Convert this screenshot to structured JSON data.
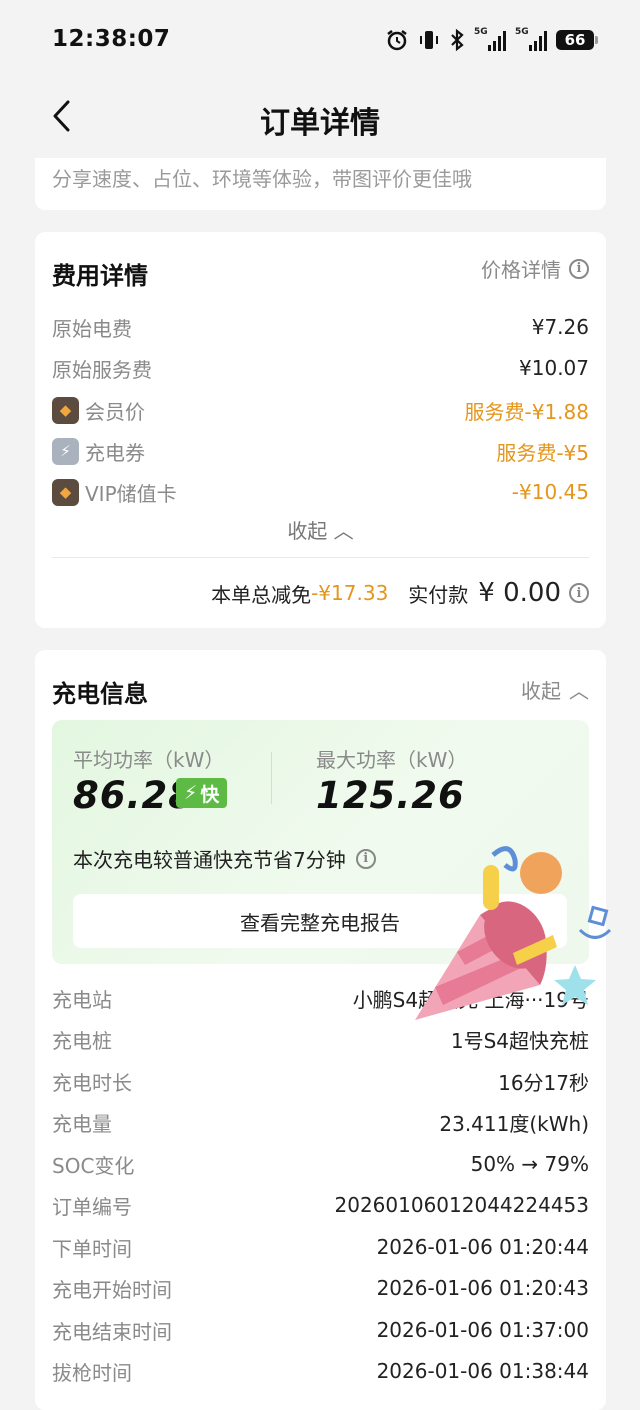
{
  "status_bar": {
    "time": "12:38:07",
    "battery": "66",
    "net1": "5G",
    "net2": "5G"
  },
  "header": {
    "title": "订单详情"
  },
  "review_tip": "分享速度、占位、环境等体验，带图评价更佳哦",
  "fees": {
    "title": "费用详情",
    "price_link": "价格详情",
    "rows": [
      {
        "label": "原始电费",
        "value": "¥7.26"
      },
      {
        "label": "原始服务费",
        "value": "¥10.07"
      },
      {
        "label": "会员价",
        "value": "服务费-¥1.88"
      },
      {
        "label": "充电券",
        "value": "服务费-¥5"
      },
      {
        "label": "VIP储值卡",
        "value": "-¥10.45"
      }
    ],
    "collapse": "收起",
    "total_label": "本单总减免",
    "total_discount": "-¥17.33",
    "paid_label": "实付款",
    "paid_value": "¥ 0.00"
  },
  "charging": {
    "title": "充电信息",
    "collapse": "收起",
    "avg_label": "平均功率（kW）",
    "avg_value": "86.28",
    "fast_tag": "快",
    "max_label": "最大功率（kW）",
    "max_value": "125.26",
    "save_note": "本次充电较普通快充节省7分钟",
    "report_button": "查看完整充电报告",
    "rows": [
      {
        "label": "充电站",
        "value": "小鹏S4超快充 上海···19号"
      },
      {
        "label": "充电桩",
        "value": "1号S4超快充桩"
      },
      {
        "label": "充电时长",
        "value": "16分17秒"
      },
      {
        "label": "充电量",
        "value": "23.411度(kWh)"
      },
      {
        "label": "SOC变化",
        "value": "50% → 79%"
      },
      {
        "label": "订单编号",
        "value": "20260106012044224453"
      },
      {
        "label": "下单时间",
        "value": "2026-01-06 01:20:44"
      },
      {
        "label": "充电开始时间",
        "value": "2026-01-06 01:20:43"
      },
      {
        "label": "充电结束时间",
        "value": "2026-01-06 01:37:00"
      },
      {
        "label": "拔枪时间",
        "value": "2026-01-06 01:38:44"
      }
    ]
  },
  "colors": {
    "accent_orange": "#e4961c",
    "fast_green": "#5dbb45"
  }
}
